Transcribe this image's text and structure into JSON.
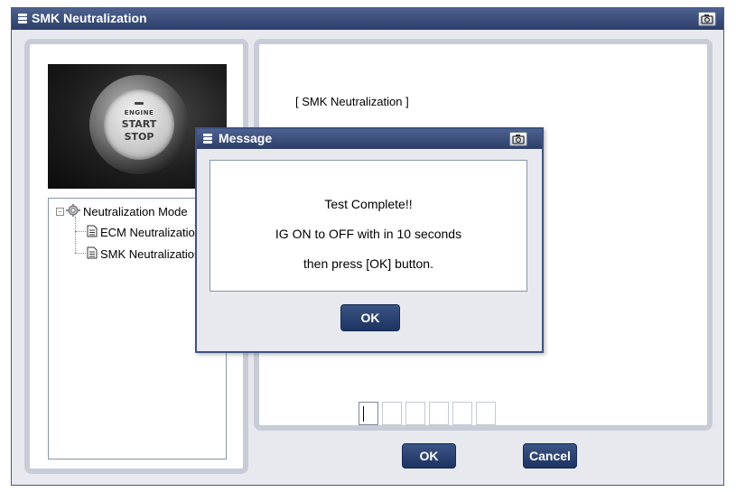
{
  "window": {
    "title": "SMK Neutralization"
  },
  "photo": {
    "button_engine": "ENGINE",
    "button_start": "START",
    "button_stop": "STOP"
  },
  "tree": {
    "root": "Neutralization Mode",
    "children": [
      "ECM Neutralization",
      "SMK Neutralization"
    ]
  },
  "content": {
    "heading": "[ SMK Neutralization ]",
    "code_boxes": 6
  },
  "buttons": {
    "ok": "OK",
    "cancel": "Cancel"
  },
  "dialog": {
    "title": "Message",
    "lines": [
      "Test Complete!!",
      "IG ON to OFF with in 10 seconds",
      "then press [OK] button."
    ],
    "ok": "OK"
  },
  "colors": {
    "titlebar": "#2c3e68",
    "button": "#1d3462",
    "panel_border": "#c7ccd7",
    "window_bg": "#e7e9ee"
  },
  "icons": {
    "title": "window-menu-icon",
    "camera": "camera-icon",
    "tree_root": "gear-icon",
    "tree_leaf": "document-icon"
  }
}
